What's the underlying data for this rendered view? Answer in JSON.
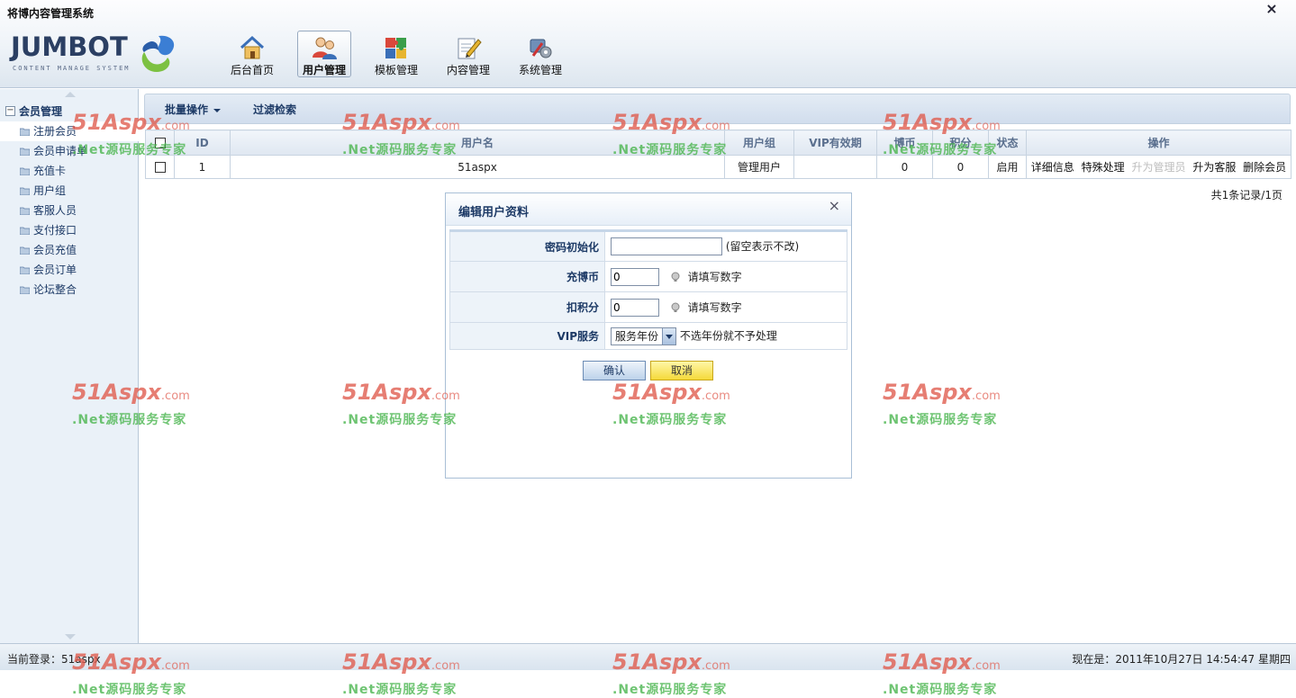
{
  "app": {
    "title": "将博内容管理系统",
    "close_symbol": "×",
    "logo_text": "JUMBOT",
    "logo_subtitle": "CONTENT MANAGE SYSTEM"
  },
  "topnav": [
    {
      "label": "后台首页",
      "icon": "home-icon",
      "active": false
    },
    {
      "label": "用户管理",
      "icon": "users-icon",
      "active": true
    },
    {
      "label": "模板管理",
      "icon": "puzzle-icon",
      "active": false
    },
    {
      "label": "内容管理",
      "icon": "document-edit-icon",
      "active": false
    },
    {
      "label": "系统管理",
      "icon": "tools-icon",
      "active": false
    }
  ],
  "sidebar": {
    "group_label": "会员管理",
    "collapse_symbol": "−",
    "items": [
      {
        "label": "注册会员",
        "selected": true
      },
      {
        "label": "会员申请单",
        "selected": false
      },
      {
        "label": "充值卡",
        "selected": false
      },
      {
        "label": "用户组",
        "selected": false
      },
      {
        "label": "客服人员",
        "selected": false
      },
      {
        "label": "支付接口",
        "selected": false
      },
      {
        "label": "会员充值",
        "selected": false
      },
      {
        "label": "会员订单",
        "selected": false
      },
      {
        "label": "论坛整合",
        "selected": false
      }
    ]
  },
  "toolbar": {
    "batch_label": "批量操作",
    "filter_label": "过滤检索"
  },
  "table": {
    "headers": [
      "ID",
      "用户名",
      "用户组",
      "VIP有效期",
      "博币",
      "积分",
      "状态",
      "操作"
    ],
    "rows": [
      {
        "id": "1",
        "username": "51aspx",
        "group": "管理用户",
        "vip_expiry": "",
        "coins": "0",
        "points": "0",
        "status": "启用",
        "ops": [
          {
            "label": "详细信息",
            "disabled": false
          },
          {
            "label": "特殊处理",
            "disabled": false
          },
          {
            "label": "升为管理员",
            "disabled": true
          },
          {
            "label": "升为客服",
            "disabled": false
          },
          {
            "label": "删除会员",
            "disabled": false
          }
        ]
      }
    ],
    "pager": "共1条记录/1页"
  },
  "dialog": {
    "title": "编辑用户资料",
    "close_symbol": "×",
    "fields": {
      "password_label": "密码初始化",
      "password_value": "",
      "password_note": "(留空表示不改)",
      "coin_label": "充博币",
      "coin_value": "0",
      "coin_hint": "请填写数字",
      "points_label": "扣积分",
      "points_value": "0",
      "points_hint": "请填写数字",
      "vip_label": "VIP服务",
      "vip_selected": "服务年份",
      "vip_note": "不选年份就不予处理"
    },
    "confirm_label": "确认",
    "cancel_label": "取消"
  },
  "status": {
    "login": "当前登录：51aspx",
    "time": "现在是：2011年10月27日 14:54:47  星期四"
  },
  "watermark": {
    "main": "51Aspx",
    "domain": ".com",
    "sub": ".Net源码服务专家"
  }
}
